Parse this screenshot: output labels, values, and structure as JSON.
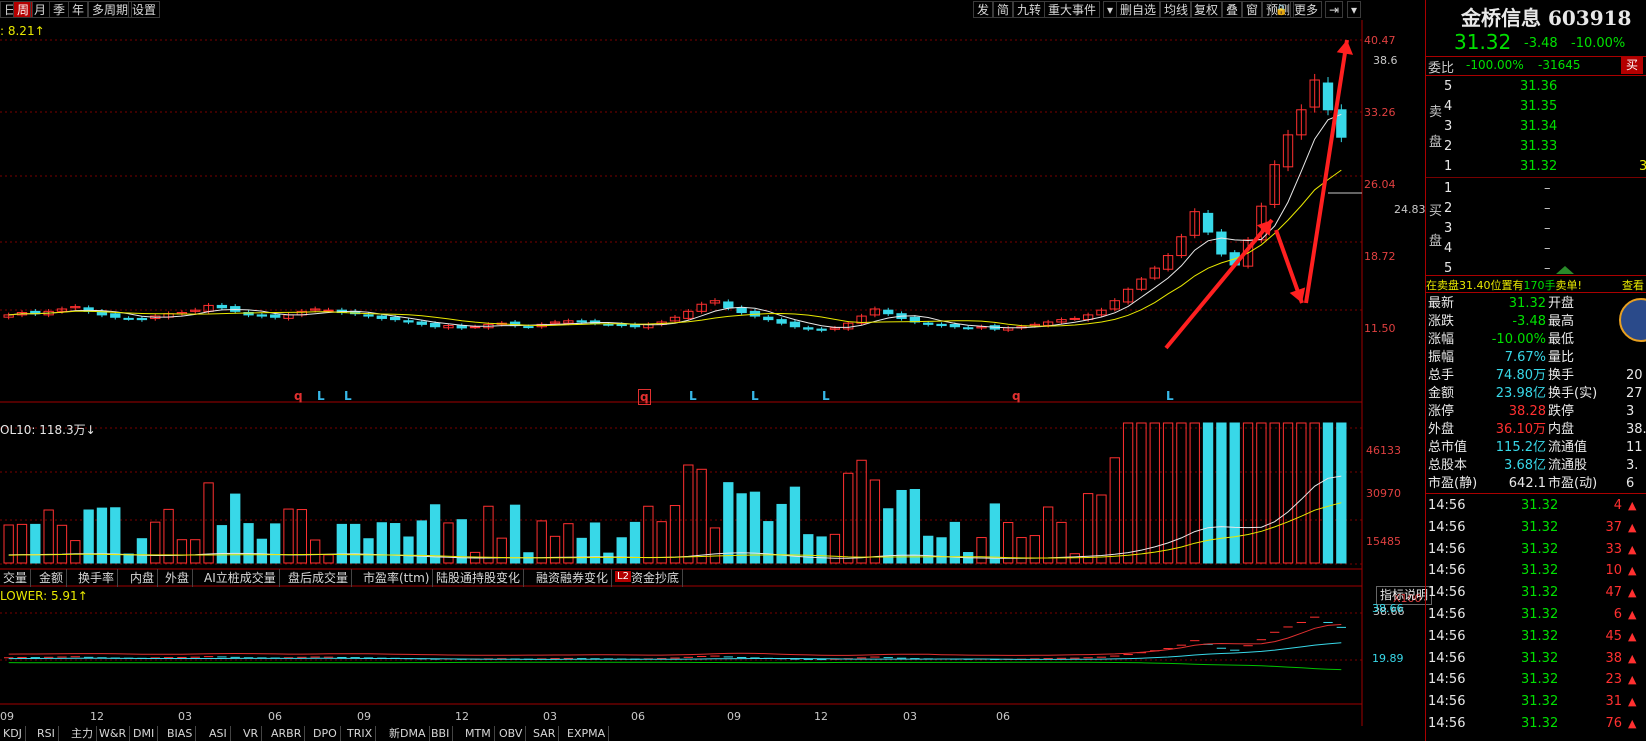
{
  "toolbar": {
    "left_items": [
      "日",
      "周",
      "月",
      "季",
      "年",
      "多周期",
      "设置"
    ],
    "active": "周",
    "right_items": [
      "发",
      "简",
      "九转",
      "重大事件",
      "删自选",
      "均线",
      "复权",
      "叠",
      "窗",
      "预测",
      "更多"
    ]
  },
  "price_panel": {
    "ma_label": ": 8.21↑",
    "axis_labels": [
      "40.47",
      "33.26",
      "26.04",
      "18.72",
      "11.50"
    ],
    "high_label": "38.6",
    "ma_value_label": "24.83",
    "signals": [
      "q",
      "L",
      "L",
      "q",
      "L",
      "L",
      "L",
      "q",
      "L"
    ]
  },
  "volume_panel": {
    "label": "OL10: 118.3万↓",
    "axis_labels": [
      "46133",
      "30970",
      "15485"
    ],
    "unit": "X100"
  },
  "indicator_tabs": [
    "交量",
    "金额",
    "换手率",
    "内盘",
    "外盘",
    "AI立桩成交量",
    "盘后成交量",
    "市盈率(ttm)",
    "陆股通持股变化",
    "融资融券变化",
    "资金抄底"
  ],
  "l2_badge": "L2",
  "lower_panel": {
    "label": "LOWER: 5.91↑",
    "explain_button": "指标说明",
    "axis_labels": [
      "38.66",
      "19.89"
    ],
    "high_label": "38.66"
  },
  "months": [
    "09",
    "12",
    "03",
    "06",
    "09",
    "12",
    "03",
    "06",
    "09",
    "12",
    "03",
    "06"
  ],
  "bottom_tabs": [
    "KDJ",
    "RSI",
    "主力",
    "W&R",
    "DMI",
    "BIAS",
    "ASI",
    "VR",
    "ARBR",
    "DPO",
    "TRIX",
    "新DMA",
    "BBI",
    "MTM",
    "OBV",
    "SAR",
    "EXPMA"
  ],
  "quote": {
    "name_code": "金桥信息 603918",
    "price": "31.32",
    "change": "-3.48",
    "change_pct": "-10.00%",
    "weibi_label": "委比",
    "weibi_pct": "-100.00%",
    "weibi_diff": "-31645",
    "buy_button": "买",
    "sell_side_label": "卖盘",
    "buy_side_label": "买盘",
    "sell_levels": [
      {
        "level": "5",
        "price": "31.36"
      },
      {
        "level": "4",
        "price": "31.35"
      },
      {
        "level": "3",
        "price": "31.34"
      },
      {
        "level": "2",
        "price": "31.33"
      },
      {
        "level": "1",
        "price": "31.32",
        "vol": "3"
      }
    ],
    "buy_levels": [
      {
        "level": "1",
        "price": "–"
      },
      {
        "level": "2",
        "price": "–"
      },
      {
        "level": "3",
        "price": "–"
      },
      {
        "level": "4",
        "price": "–"
      },
      {
        "level": "5",
        "price": "–"
      }
    ],
    "notice": "在卖盘31.40位置有",
    "notice_qty": "170手",
    "notice_tail": "卖单!",
    "notice_link": "查看",
    "stats": [
      {
        "k1": "最新",
        "v1": "31.32",
        "k2": "开盘",
        "v2": ""
      },
      {
        "k1": "涨跌",
        "v1": "-3.48",
        "k2": "最高",
        "v2": ""
      },
      {
        "k1": "涨幅",
        "v1": "-10.00%",
        "k2": "最低",
        "v2": ""
      },
      {
        "k1": "振幅",
        "v1": "7.67%",
        "k2": "量比",
        "v2": ""
      },
      {
        "k1": "总手",
        "v1": "74.80万",
        "k2": "换手",
        "v2": "20"
      },
      {
        "k1": "金额",
        "v1": "23.98亿",
        "k2": "换手(实)",
        "v2": "27"
      },
      {
        "k1": "涨停",
        "v1": "38.28",
        "k2": "跌停",
        "v2": "3"
      },
      {
        "k1": "外盘",
        "v1": "36.10万",
        "k2": "内盘",
        "v2": "38."
      },
      {
        "k1": "总市值",
        "v1": "115.2亿",
        "k2": "流通值",
        "v2": "11"
      },
      {
        "k1": "总股本",
        "v1": "3.68亿",
        "k2": "流通股",
        "v2": "3."
      },
      {
        "k1": "市盈(静)",
        "v1": "642.1",
        "k2": "市盈(动)",
        "v2": "6"
      }
    ],
    "ticks": [
      {
        "time": "14:56",
        "price": "31.32",
        "vol": "4"
      },
      {
        "time": "14:56",
        "price": "31.32",
        "vol": "37"
      },
      {
        "time": "14:56",
        "price": "31.32",
        "vol": "33"
      },
      {
        "time": "14:56",
        "price": "31.32",
        "vol": "10"
      },
      {
        "time": "14:56",
        "price": "31.32",
        "vol": "47"
      },
      {
        "time": "14:56",
        "price": "31.32",
        "vol": "6"
      },
      {
        "time": "14:56",
        "price": "31.32",
        "vol": "45"
      },
      {
        "time": "14:56",
        "price": "31.32",
        "vol": "38"
      },
      {
        "time": "14:56",
        "price": "31.32",
        "vol": "23"
      },
      {
        "time": "14:56",
        "price": "31.32",
        "vol": "31"
      },
      {
        "time": "14:56",
        "price": "31.32",
        "vol": "76"
      }
    ]
  },
  "colors": {
    "up": "#ff3030",
    "down": "#38d8e8",
    "ma1": "#e8e8e8",
    "ma2": "#e8e800",
    "grid": "#5a0000",
    "accent": "#b40000"
  },
  "chart_data": {
    "type": "candlestick",
    "price_axis": [
      11.5,
      40.47
    ],
    "closes": [
      9.6,
      9.8,
      9.7,
      9.9,
      10.1,
      10.3,
      9.9,
      9.6,
      9.4,
      9.3,
      9.2,
      9.5,
      9.7,
      9.8,
      10.0,
      10.4,
      10.2,
      9.9,
      9.6,
      9.5,
      9.4,
      9.6,
      9.9,
      10.1,
      10.0,
      9.8,
      9.7,
      9.5,
      9.3,
      9.2,
      9.0,
      8.8,
      8.6,
      8.7,
      8.5,
      8.6,
      8.8,
      8.9,
      8.7,
      8.6,
      8.8,
      9.0,
      9.1,
      9.0,
      8.9,
      8.8,
      8.7,
      8.6,
      8.8,
      9.0,
      9.4,
      9.9,
      10.5,
      10.8,
      10.2,
      9.8,
      9.5,
      9.2,
      8.9,
      8.6,
      8.4,
      8.3,
      8.5,
      8.9,
      9.5,
      10.1,
      9.7,
      9.3,
      9.0,
      8.8,
      8.7,
      8.6,
      8.5,
      8.6,
      8.4,
      8.5,
      8.6,
      8.8,
      9.0,
      9.2,
      9.3,
      9.6,
      10.0,
      10.8,
      11.9,
      13.2,
      14.6,
      16.2,
      18.6,
      21.8,
      19.2,
      16.4,
      15.0,
      18.2,
      22.5,
      27.8,
      31.6,
      34.8,
      38.6,
      34.8,
      31.3
    ]
  }
}
